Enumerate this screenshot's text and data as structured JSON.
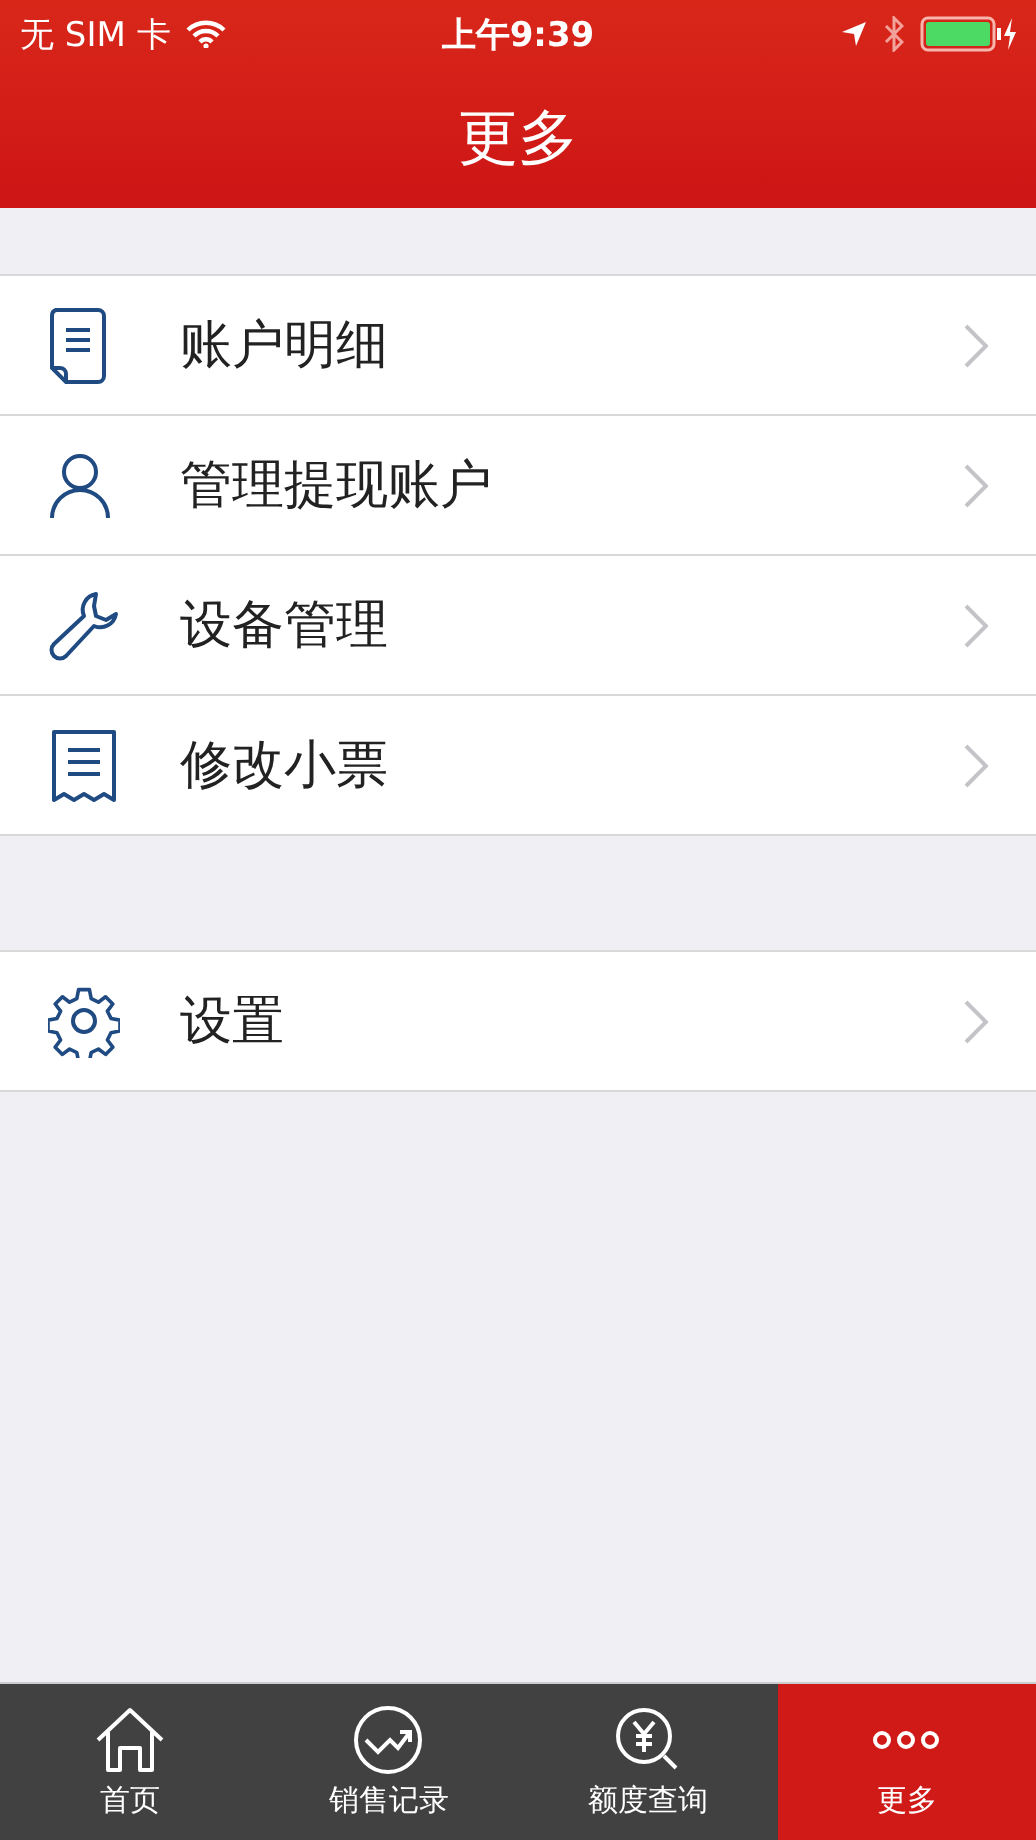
{
  "status_bar": {
    "carrier": "无 SIM 卡",
    "time": "上午9:39"
  },
  "nav": {
    "title": "更多"
  },
  "groups": [
    {
      "items": [
        {
          "label": "账户明细",
          "kind": "document"
        },
        {
          "label": "管理提现账户",
          "kind": "person"
        },
        {
          "label": "设备管理",
          "kind": "wrench"
        },
        {
          "label": "修改小票",
          "kind": "receipt"
        }
      ]
    },
    {
      "items": [
        {
          "label": "设置",
          "kind": "gear"
        }
      ]
    }
  ],
  "tabs": [
    {
      "label": "首页",
      "kind": "home",
      "selected": false
    },
    {
      "label": "销售记录",
      "kind": "chart",
      "selected": false
    },
    {
      "label": "额度查询",
      "kind": "search",
      "selected": false
    },
    {
      "label": "更多",
      "kind": "more",
      "selected": true
    }
  ]
}
